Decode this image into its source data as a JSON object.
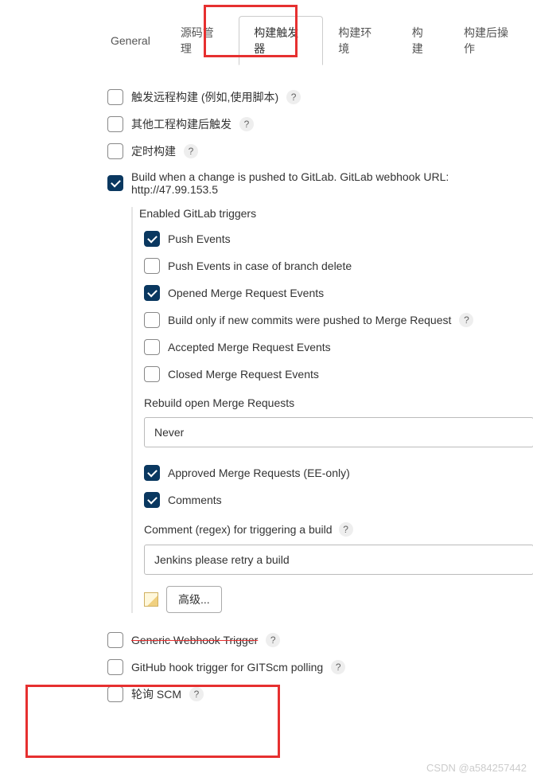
{
  "tabs": {
    "general": "General",
    "scm": "源码管理",
    "triggers": "构建触发器",
    "env": "构建环境",
    "build": "构建",
    "post": "构建后操作"
  },
  "triggers": {
    "remote_build": "触发远程构建 (例如,使用脚本)",
    "after_other": "其他工程构建后触发",
    "scheduled": "定时构建",
    "gitlab_label": "Build when a change is pushed to GitLab. GitLab webhook URL: http://47.99.153.5",
    "gitlab": {
      "section_title": "Enabled GitLab triggers",
      "push": "Push Events",
      "push_delete": "Push Events in case of branch delete",
      "opened_mr": "Opened Merge Request Events",
      "build_only_new": "Build only if new commits were pushed to Merge Request",
      "accepted_mr": "Accepted Merge Request Events",
      "closed_mr": "Closed Merge Request Events",
      "rebuild_label": "Rebuild open Merge Requests",
      "rebuild_value": "Never",
      "approved_mr": "Approved Merge Requests (EE-only)",
      "comments": "Comments",
      "comment_regex_label": "Comment (regex) for triggering a build",
      "comment_regex_value": "Jenkins please retry a build",
      "advanced_btn": "高级..."
    },
    "generic_webhook": "Generic Webhook Trigger",
    "github_hook": "GitHub hook trigger for GITScm polling",
    "poll_scm": "轮询 SCM"
  },
  "watermark": "CSDN @a584257442"
}
